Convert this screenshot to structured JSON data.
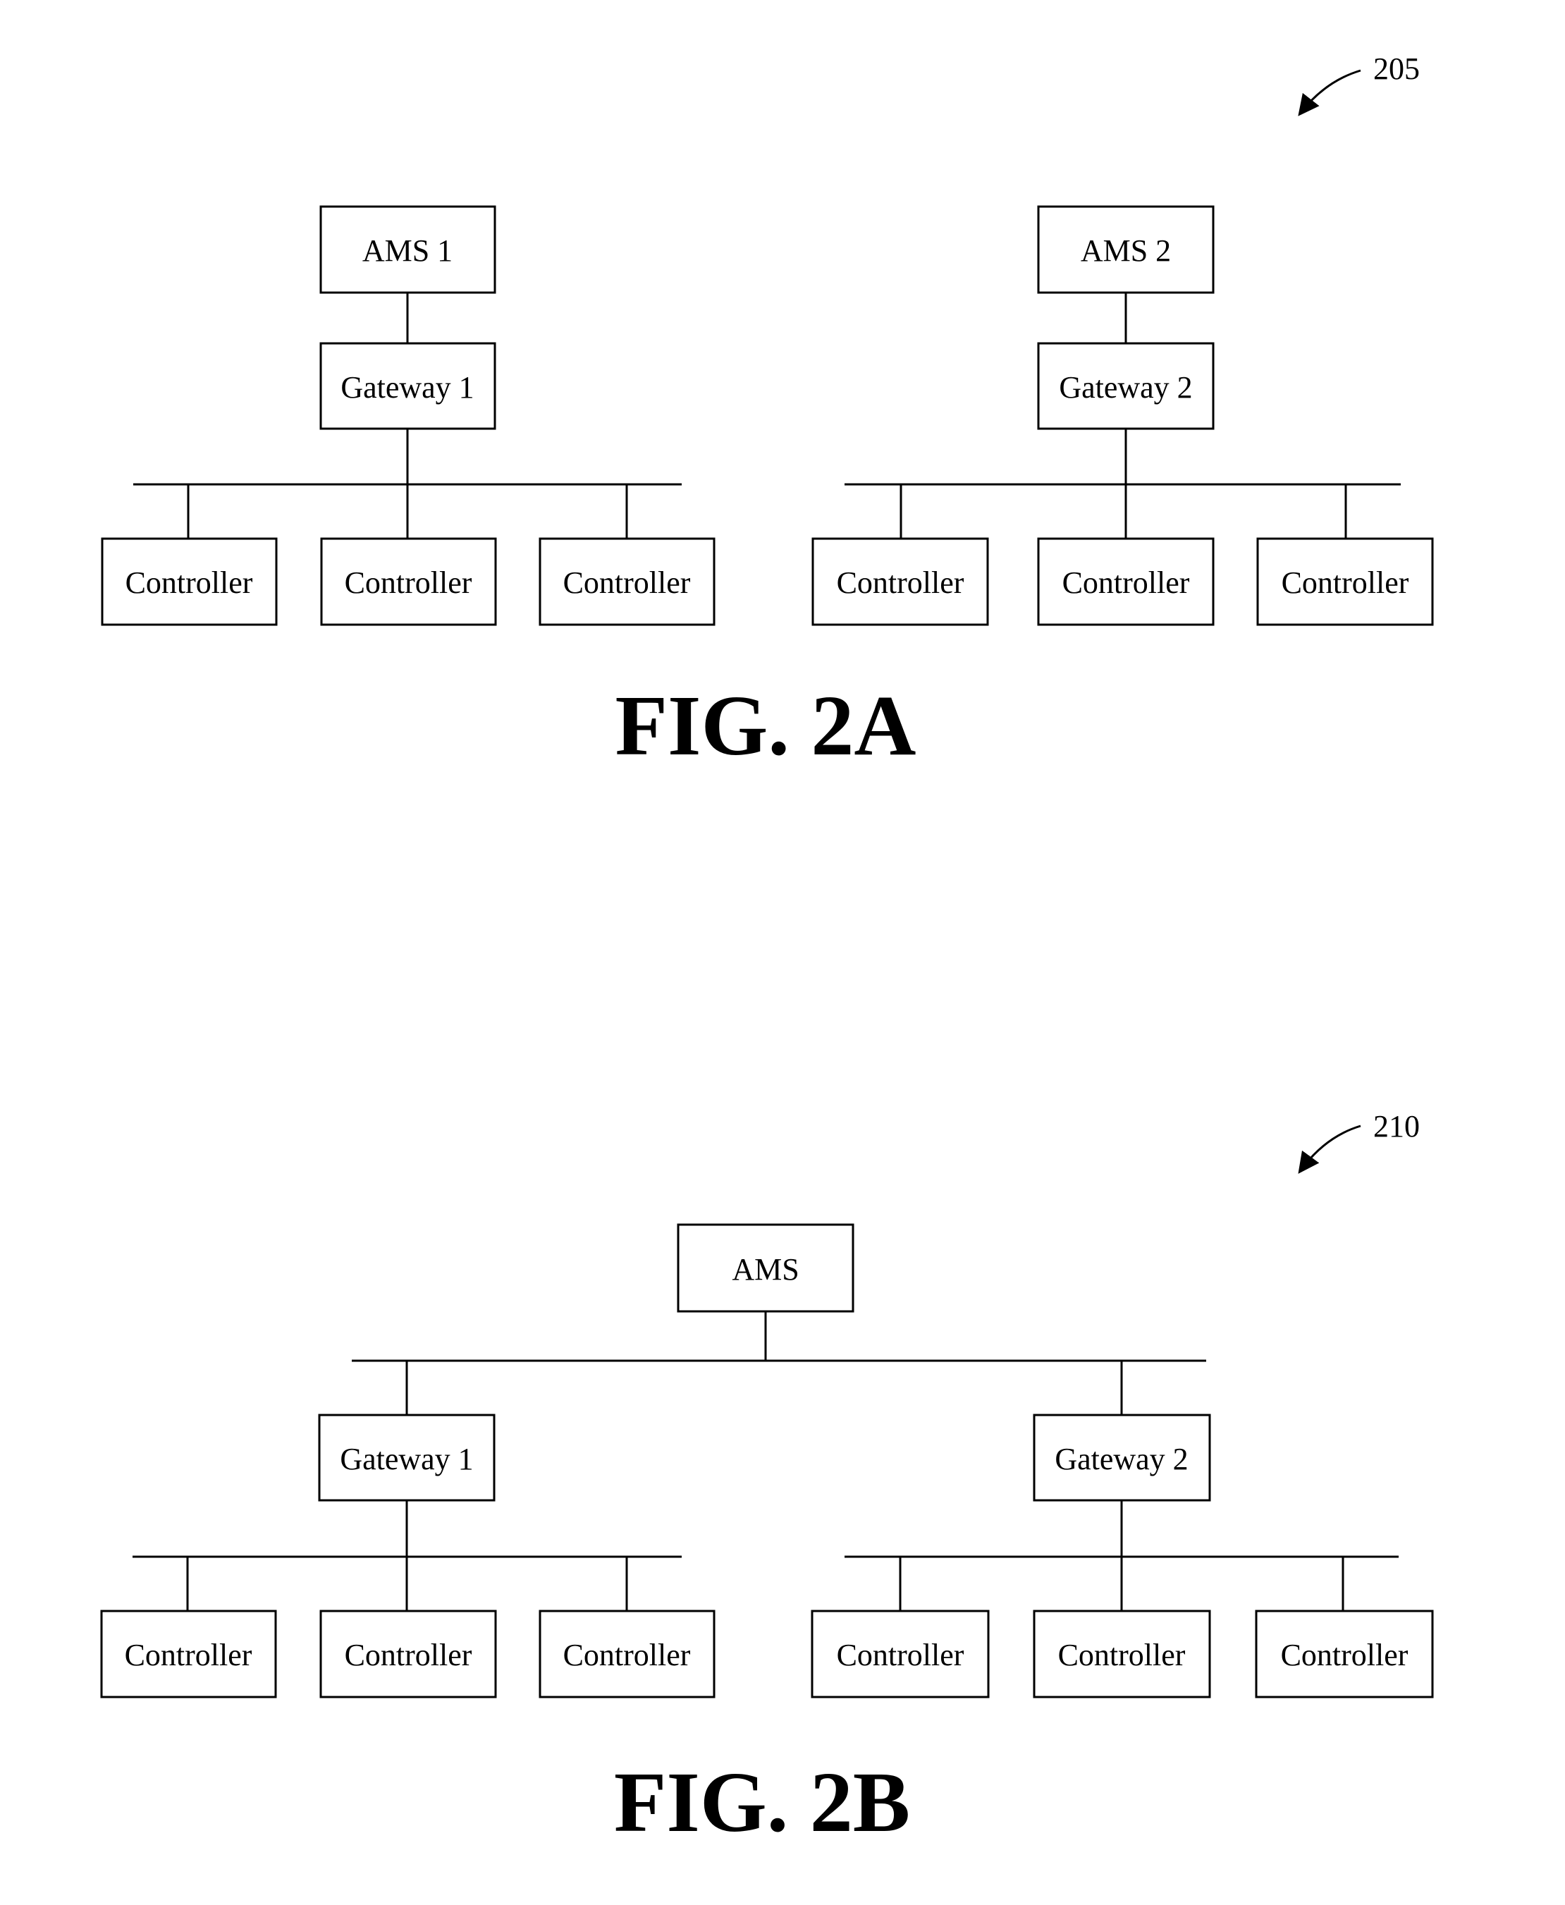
{
  "figures": [
    {
      "id": "fig-2a",
      "caption": "FIG. 2A",
      "reference_numeral": "205",
      "systems": [
        {
          "ams": "AMS 1",
          "gateway": "Gateway 1",
          "controllers": [
            "Controller",
            "Controller",
            "Controller"
          ]
        },
        {
          "ams": "AMS 2",
          "gateway": "Gateway 2",
          "controllers": [
            "Controller",
            "Controller",
            "Controller"
          ]
        }
      ]
    },
    {
      "id": "fig-2b",
      "caption": "FIG. 2B",
      "reference_numeral": "210",
      "ams": "AMS",
      "gateways": [
        {
          "label": "Gateway 1",
          "controllers": [
            "Controller",
            "Controller",
            "Controller"
          ]
        },
        {
          "label": "Gateway 2",
          "controllers": [
            "Controller",
            "Controller",
            "Controller"
          ]
        }
      ]
    }
  ]
}
